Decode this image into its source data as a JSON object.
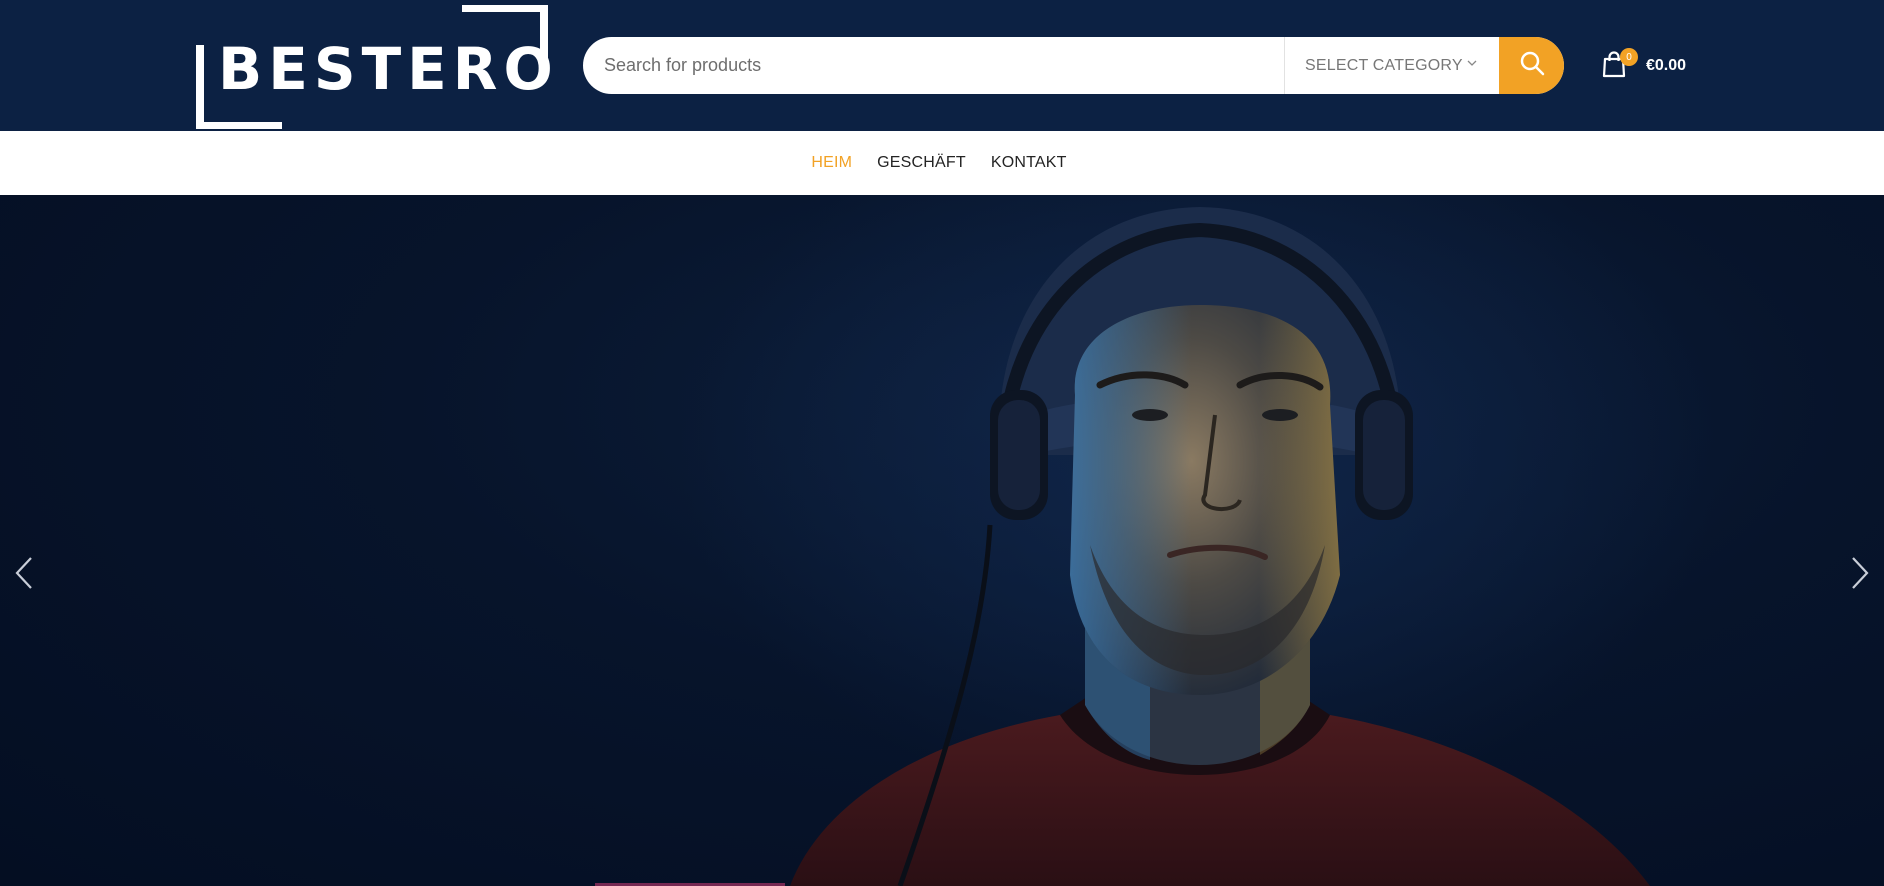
{
  "brand": {
    "logo_text": "BESTERO"
  },
  "search": {
    "placeholder": "Search for products",
    "category_label": "SELECT CATEGORY"
  },
  "cart": {
    "count": "0",
    "amount": "€0.00"
  },
  "nav": {
    "items": [
      {
        "label": "HEIM"
      },
      {
        "label": "GESCHÄFT"
      },
      {
        "label": "KONTAKT"
      }
    ]
  },
  "colors": {
    "header_bg": "#0c2143",
    "accent": "#f2a225",
    "hero_bg": "#07142b"
  },
  "icons": {
    "search": "search-icon",
    "cart": "shopping-bag-icon",
    "chevron": "chevron-down-icon",
    "prev": "chevron-left-icon",
    "next": "chevron-right-icon"
  }
}
